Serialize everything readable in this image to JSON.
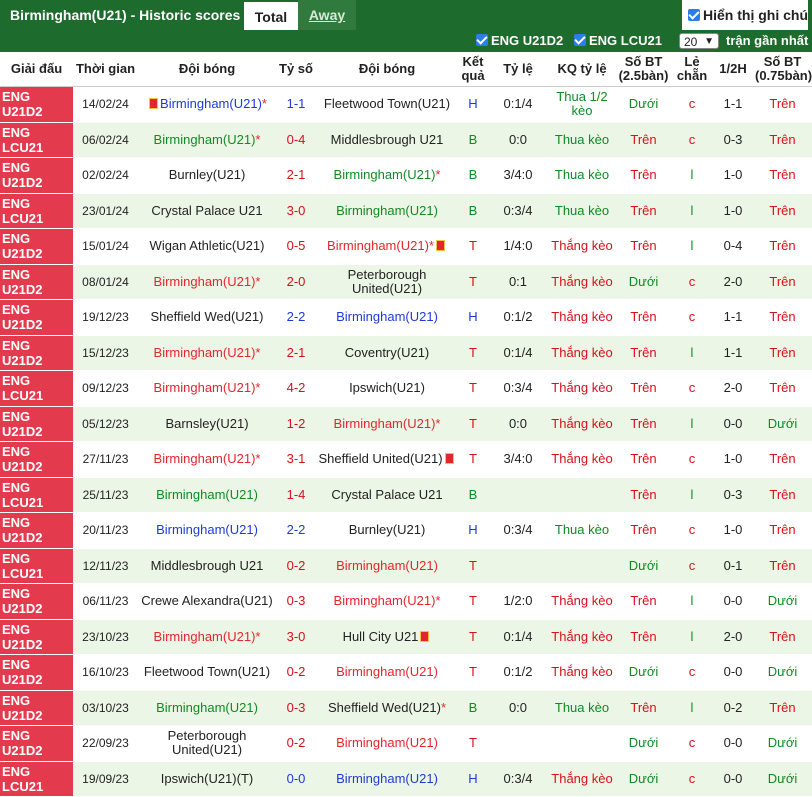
{
  "header": {
    "title": "Birmingham(U21) - Historic scores",
    "tab_total": "Total",
    "tab_away": "Away",
    "show_notes": "Hiển thị ghi chú"
  },
  "filters": {
    "league1": "ENG U21D2",
    "league2": "ENG LCU21",
    "count_value": "20",
    "recent_label": "trận gần nhất"
  },
  "columns": [
    "Giải đấu",
    "Thời gian",
    "Đội bóng",
    "Tỷ số",
    "Đội bóng",
    "Kết quả",
    "Tỷ lệ",
    "KQ tỷ lệ",
    "Số BT (2.5bàn)",
    "Lẻ chẵn",
    "1/2H",
    "Số BT (0.75bàn)"
  ],
  "rows": [
    {
      "league": "ENG U21D2",
      "date": "14/02/24",
      "home": "Birmingham(U21)",
      "away": "Fleetwood Town(U21)",
      "score": "1-1",
      "res": "H",
      "odds": "0:1/4",
      "ko": "Thua 1/2 kèo",
      "bt": "Dưới",
      "lc": "c",
      "half": "1-1",
      "bt2": "Trên"
    },
    {
      "league": "ENG LCU21",
      "date": "06/02/24",
      "home": "Birmingham(U21)",
      "away": "Middlesbrough U21",
      "score": "0-4",
      "res": "B",
      "odds": "0:0",
      "ko": "Thua kèo",
      "bt": "Trên",
      "lc": "c",
      "half": "0-3",
      "bt2": "Trên"
    },
    {
      "league": "ENG U21D2",
      "date": "02/02/24",
      "home": "Burnley(U21)",
      "away": "Birmingham(U21)",
      "score": "2-1",
      "res": "B",
      "odds": "3/4:0",
      "ko": "Thua kèo",
      "bt": "Trên",
      "lc": "l",
      "half": "1-0",
      "bt2": "Trên"
    },
    {
      "league": "ENG LCU21",
      "date": "23/01/24",
      "home": "Crystal Palace U21",
      "away": "Birmingham(U21)",
      "score": "3-0",
      "res": "B",
      "odds": "0:3/4",
      "ko": "Thua kèo",
      "bt": "Trên",
      "lc": "l",
      "half": "1-0",
      "bt2": "Trên"
    },
    {
      "league": "ENG U21D2",
      "date": "15/01/24",
      "home": "Wigan Athletic(U21)",
      "away": "Birmingham(U21)",
      "score": "0-5",
      "res": "T",
      "odds": "1/4:0",
      "ko": "Thắng kèo",
      "bt": "Trên",
      "lc": "l",
      "half": "0-4",
      "bt2": "Trên"
    },
    {
      "league": "ENG U21D2",
      "date": "08/01/24",
      "home": "Birmingham(U21)",
      "away": "Peterborough United(U21)",
      "score": "2-0",
      "res": "T",
      "odds": "0:1",
      "ko": "Thắng kèo",
      "bt": "Dưới",
      "lc": "c",
      "half": "2-0",
      "bt2": "Trên"
    },
    {
      "league": "ENG U21D2",
      "date": "19/12/23",
      "home": "Sheffield Wed(U21)",
      "away": "Birmingham(U21)",
      "score": "2-2",
      "res": "H",
      "odds": "0:1/2",
      "ko": "Thắng kèo",
      "bt": "Trên",
      "lc": "c",
      "half": "1-1",
      "bt2": "Trên"
    },
    {
      "league": "ENG U21D2",
      "date": "15/12/23",
      "home": "Birmingham(U21)",
      "away": "Coventry(U21)",
      "score": "2-1",
      "res": "T",
      "odds": "0:1/4",
      "ko": "Thắng kèo",
      "bt": "Trên",
      "lc": "l",
      "half": "1-1",
      "bt2": "Trên"
    },
    {
      "league": "ENG LCU21",
      "date": "09/12/23",
      "home": "Birmingham(U21)",
      "away": "Ipswich(U21)",
      "score": "4-2",
      "res": "T",
      "odds": "0:3/4",
      "ko": "Thắng kèo",
      "bt": "Trên",
      "lc": "c",
      "half": "2-0",
      "bt2": "Trên"
    },
    {
      "league": "ENG U21D2",
      "date": "05/12/23",
      "home": "Barnsley(U21)",
      "away": "Birmingham(U21)",
      "score": "1-2",
      "res": "T",
      "odds": "0:0",
      "ko": "Thắng kèo",
      "bt": "Trên",
      "lc": "l",
      "half": "0-0",
      "bt2": "Dưới"
    },
    {
      "league": "ENG U21D2",
      "date": "27/11/23",
      "home": "Birmingham(U21)",
      "away": "Sheffield United(U21)",
      "score": "3-1",
      "res": "T",
      "odds": "3/4:0",
      "ko": "Thắng kèo",
      "bt": "Trên",
      "lc": "c",
      "half": "1-0",
      "bt2": "Trên"
    },
    {
      "league": "ENG LCU21",
      "date": "25/11/23",
      "home": "Birmingham(U21)",
      "away": "Crystal Palace U21",
      "score": "1-4",
      "res": "B",
      "odds": "",
      "ko": "",
      "bt": "Trên",
      "lc": "l",
      "half": "0-3",
      "bt2": "Trên"
    },
    {
      "league": "ENG U21D2",
      "date": "20/11/23",
      "home": "Birmingham(U21)",
      "away": "Burnley(U21)",
      "score": "2-2",
      "res": "H",
      "odds": "0:3/4",
      "ko": "Thua kèo",
      "bt": "Trên",
      "lc": "c",
      "half": "1-0",
      "bt2": "Trên"
    },
    {
      "league": "ENG LCU21",
      "date": "12/11/23",
      "home": "Middlesbrough U21",
      "away": "Birmingham(U21)",
      "score": "0-2",
      "res": "T",
      "odds": "",
      "ko": "",
      "bt": "Dưới",
      "lc": "c",
      "half": "0-1",
      "bt2": "Trên"
    },
    {
      "league": "ENG U21D2",
      "date": "06/11/23",
      "home": "Crewe Alexandra(U21)",
      "away": "Birmingham(U21)",
      "score": "0-3",
      "res": "T",
      "odds": "1/2:0",
      "ko": "Thắng kèo",
      "bt": "Trên",
      "lc": "l",
      "half": "0-0",
      "bt2": "Dưới"
    },
    {
      "league": "ENG U21D2",
      "date": "23/10/23",
      "home": "Birmingham(U21)",
      "away": "Hull City U21",
      "score": "3-0",
      "res": "T",
      "odds": "0:1/4",
      "ko": "Thắng kèo",
      "bt": "Trên",
      "lc": "l",
      "half": "2-0",
      "bt2": "Trên"
    },
    {
      "league": "ENG U21D2",
      "date": "16/10/23",
      "home": "Fleetwood Town(U21)",
      "away": "Birmingham(U21)",
      "score": "0-2",
      "res": "T",
      "odds": "0:1/2",
      "ko": "Thắng kèo",
      "bt": "Dưới",
      "lc": "c",
      "half": "0-0",
      "bt2": "Dưới"
    },
    {
      "league": "ENG U21D2",
      "date": "03/10/23",
      "home": "Birmingham(U21)",
      "away": "Sheffield Wed(U21)",
      "score": "0-3",
      "res": "B",
      "odds": "0:0",
      "ko": "Thua kèo",
      "bt": "Trên",
      "lc": "l",
      "half": "0-2",
      "bt2": "Trên"
    },
    {
      "league": "ENG U21D2",
      "date": "22/09/23",
      "home": "Peterborough United(U21)",
      "away": "Birmingham(U21)",
      "score": "0-2",
      "res": "T",
      "odds": "",
      "ko": "",
      "bt": "Dưới",
      "lc": "c",
      "half": "0-0",
      "bt2": "Dưới"
    },
    {
      "league": "ENG LCU21",
      "date": "19/09/23",
      "home": "Ipswich(U21)(T)",
      "away": "Birmingham(U21)",
      "score": "0-0",
      "res": "H",
      "odds": "0:3/4",
      "ko": "Thắng kèo",
      "bt": "Dưới",
      "lc": "c",
      "half": "0-0",
      "bt2": "Dưới"
    }
  ],
  "markers": {
    "home_star": "*"
  },
  "colors": {
    "header_green": "#1d6b2d",
    "league_red": "#e33a4d",
    "row_alt": "#ecf6e6",
    "red_text": "#e3262e",
    "blue_text": "#1e3bd6",
    "green_text": "#128a24"
  }
}
